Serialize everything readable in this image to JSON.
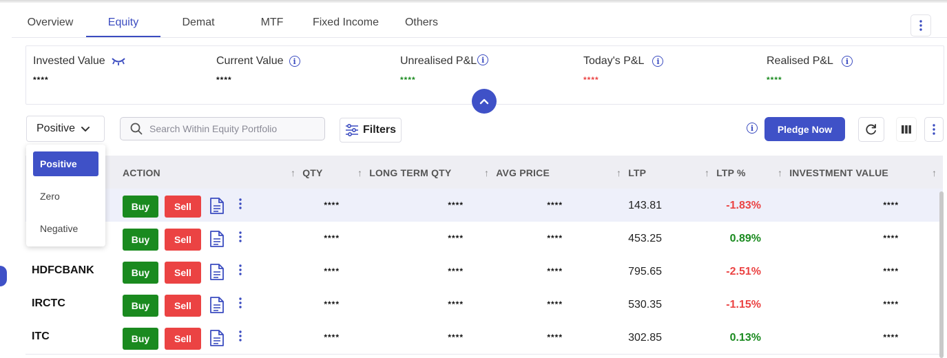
{
  "tabs": [
    "Overview",
    "Equity",
    "Demat",
    "MTF",
    "Fixed Income",
    "Others"
  ],
  "active_tab": "Equity",
  "summary": {
    "invested": {
      "label": "Invested Value",
      "value": "****"
    },
    "current": {
      "label": "Current Value",
      "value": "****"
    },
    "unrealised": {
      "label": "Unrealised P&L",
      "value": "****"
    },
    "todays": {
      "label": "Today's P&L",
      "value": "****"
    },
    "realised": {
      "label": "Realised P&L",
      "value": "****"
    }
  },
  "colors": {
    "accent": "#3f51c7",
    "buy": "#1a8a1f",
    "sell": "#eb4343",
    "positive": "#1a8a1f",
    "negative": "#eb4343"
  },
  "controls": {
    "filter_selected": "Positive",
    "search_placeholder": "Search Within Equity Portfolio",
    "filters_label": "Filters",
    "pledge_label": "Pledge Now"
  },
  "dropdown_options": [
    "Positive",
    "Zero",
    "Negative"
  ],
  "table": {
    "headers": {
      "action": "ACTION",
      "qty": "QTY",
      "long_term_qty": "LONG TERM QTY",
      "avg_price": "AVG PRICE",
      "ltp": "LTP",
      "ltp_pct": "LTP %",
      "investment_value": "INVESTMENT VALUE"
    },
    "buy_label": "Buy",
    "sell_label": "Sell",
    "rows": [
      {
        "symbol": "",
        "qty": "****",
        "ltq": "****",
        "avg": "****",
        "ltp": "143.81",
        "pct": "-1.83%",
        "inv": "****"
      },
      {
        "symbol": "",
        "qty": "****",
        "ltq": "****",
        "avg": "****",
        "ltp": "453.25",
        "pct": "0.89%",
        "inv": "****"
      },
      {
        "symbol": "HDFCBANK",
        "qty": "****",
        "ltq": "****",
        "avg": "****",
        "ltp": "795.65",
        "pct": "-2.51%",
        "inv": "****"
      },
      {
        "symbol": "IRCTC",
        "qty": "****",
        "ltq": "****",
        "avg": "****",
        "ltp": "530.35",
        "pct": "-1.15%",
        "inv": "****"
      },
      {
        "symbol": "ITC",
        "qty": "****",
        "ltq": "****",
        "avg": "****",
        "ltp": "302.85",
        "pct": "0.13%",
        "inv": "****"
      }
    ]
  }
}
